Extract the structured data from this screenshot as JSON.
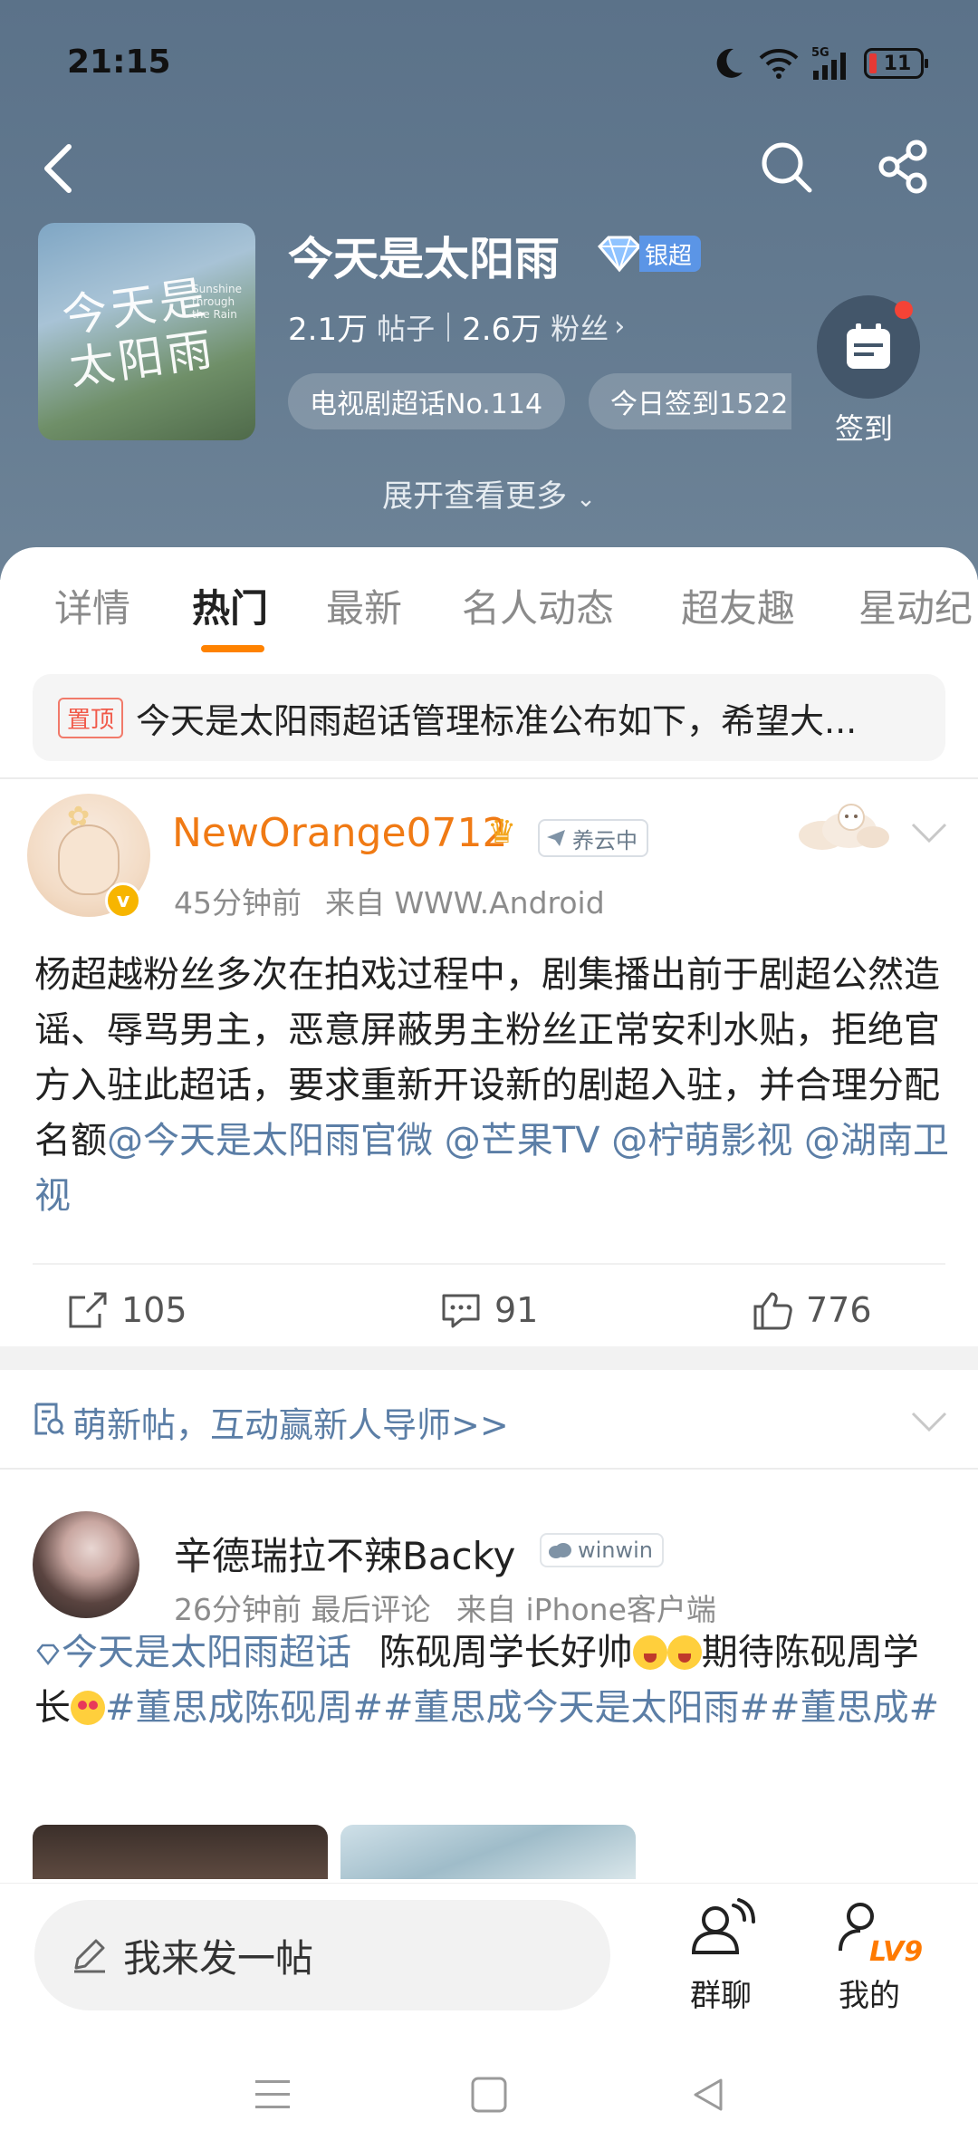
{
  "status_bar": {
    "time": "21:15",
    "battery": "11",
    "network": "5G"
  },
  "nav": {
    "back_icon": "chevron-left-icon",
    "search_icon": "search-icon",
    "share_icon": "share-icon"
  },
  "topic": {
    "cover_text": "今天是太阳雨",
    "cover_small": "Sunshine through the Rain",
    "title": "今天是太阳雨",
    "badge": "银超",
    "posts_count": "2.1万",
    "posts_label": "帖子",
    "fans_count": "2.6万",
    "fans_label": "粉丝",
    "tags": [
      "电视剧超话No.114",
      "今日签到1522"
    ],
    "sign_label": "签到",
    "expand_label": "展开查看更多"
  },
  "tabs": [
    "详情",
    "热门",
    "最新",
    "名人动态",
    "超友趣",
    "星动纪"
  ],
  "active_tab": "热门",
  "pinned": {
    "tag": "置顶",
    "text": "今天是太阳雨超话管理标准公布如下，希望大..."
  },
  "post1": {
    "username": "NewOrange0712",
    "level_label": "养云中",
    "time": "45分钟前",
    "source": "来自 WWW.Android",
    "body": "杨超越粉丝多次在拍戏过程中，剧集播出前于剧超公然造谣、辱骂男主，恶意屏蔽男主粉丝正常安利水贴，拒绝官方入驻此超话，要求重新开设新的剧超入驻，并合理分配名额",
    "mentions": "@今天是太阳雨官微 @芒果TV @柠萌影视 @湖南卫视",
    "reposts": "105",
    "comments": "91",
    "likes": "776"
  },
  "newbie": {
    "text": "萌新帖，互动赢新人导师>>"
  },
  "post2": {
    "username": "辛德瑞拉不辣Backy",
    "level_label": "winwin",
    "time": "26分钟前",
    "last_comment": "最后评论",
    "source": "来自 iPhone客户端",
    "topic_link": "今天是太阳雨超话",
    "body_a": "陈砚周学长好帅",
    "body_b": "期待陈砚周学长",
    "hashtags_a": "#董思成陈砚周##董思成今天是太阳雨##董思成#"
  },
  "bottom": {
    "compose": "我来发一帖",
    "chat": "群聊",
    "me": "我的",
    "level": "LV9"
  },
  "colors": {
    "accent": "#ff8200",
    "link": "#5b7ea6",
    "header": "#62798f",
    "username_orange": "#f07a14"
  }
}
